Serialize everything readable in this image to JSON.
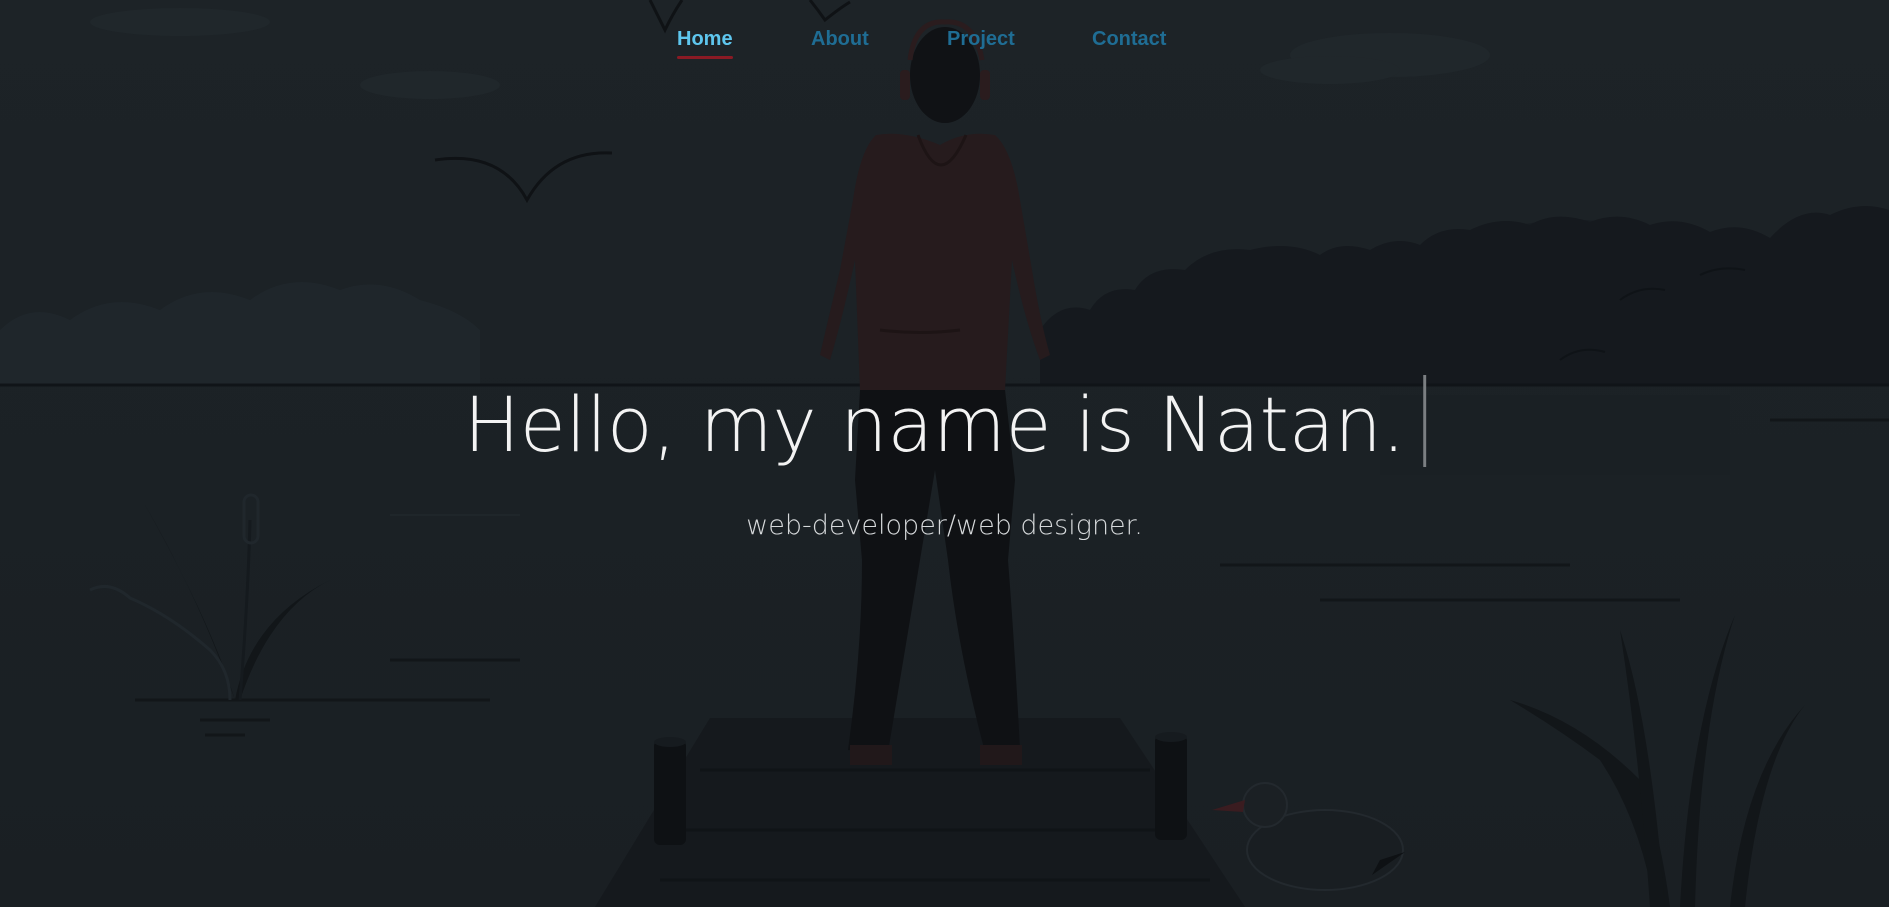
{
  "nav": {
    "items": [
      {
        "label": "Home",
        "active": true
      },
      {
        "label": "About",
        "active": false
      },
      {
        "label": "Project",
        "active": false
      },
      {
        "label": "Contact",
        "active": false
      }
    ]
  },
  "hero": {
    "headline": "Hello, my name is Natan.",
    "subtitle": "web-developer/web designer."
  },
  "colors": {
    "background": "#1c2226",
    "nav_active": "#5ec6ee",
    "nav_inactive": "#1f6d94",
    "nav_underline": "#8a1a24",
    "headline": "#f3f3f3"
  },
  "icons": [
    "bird-icon",
    "person-illustration",
    "dock-illustration",
    "seagull-icon",
    "reeds-icon",
    "hills-illustration"
  ]
}
